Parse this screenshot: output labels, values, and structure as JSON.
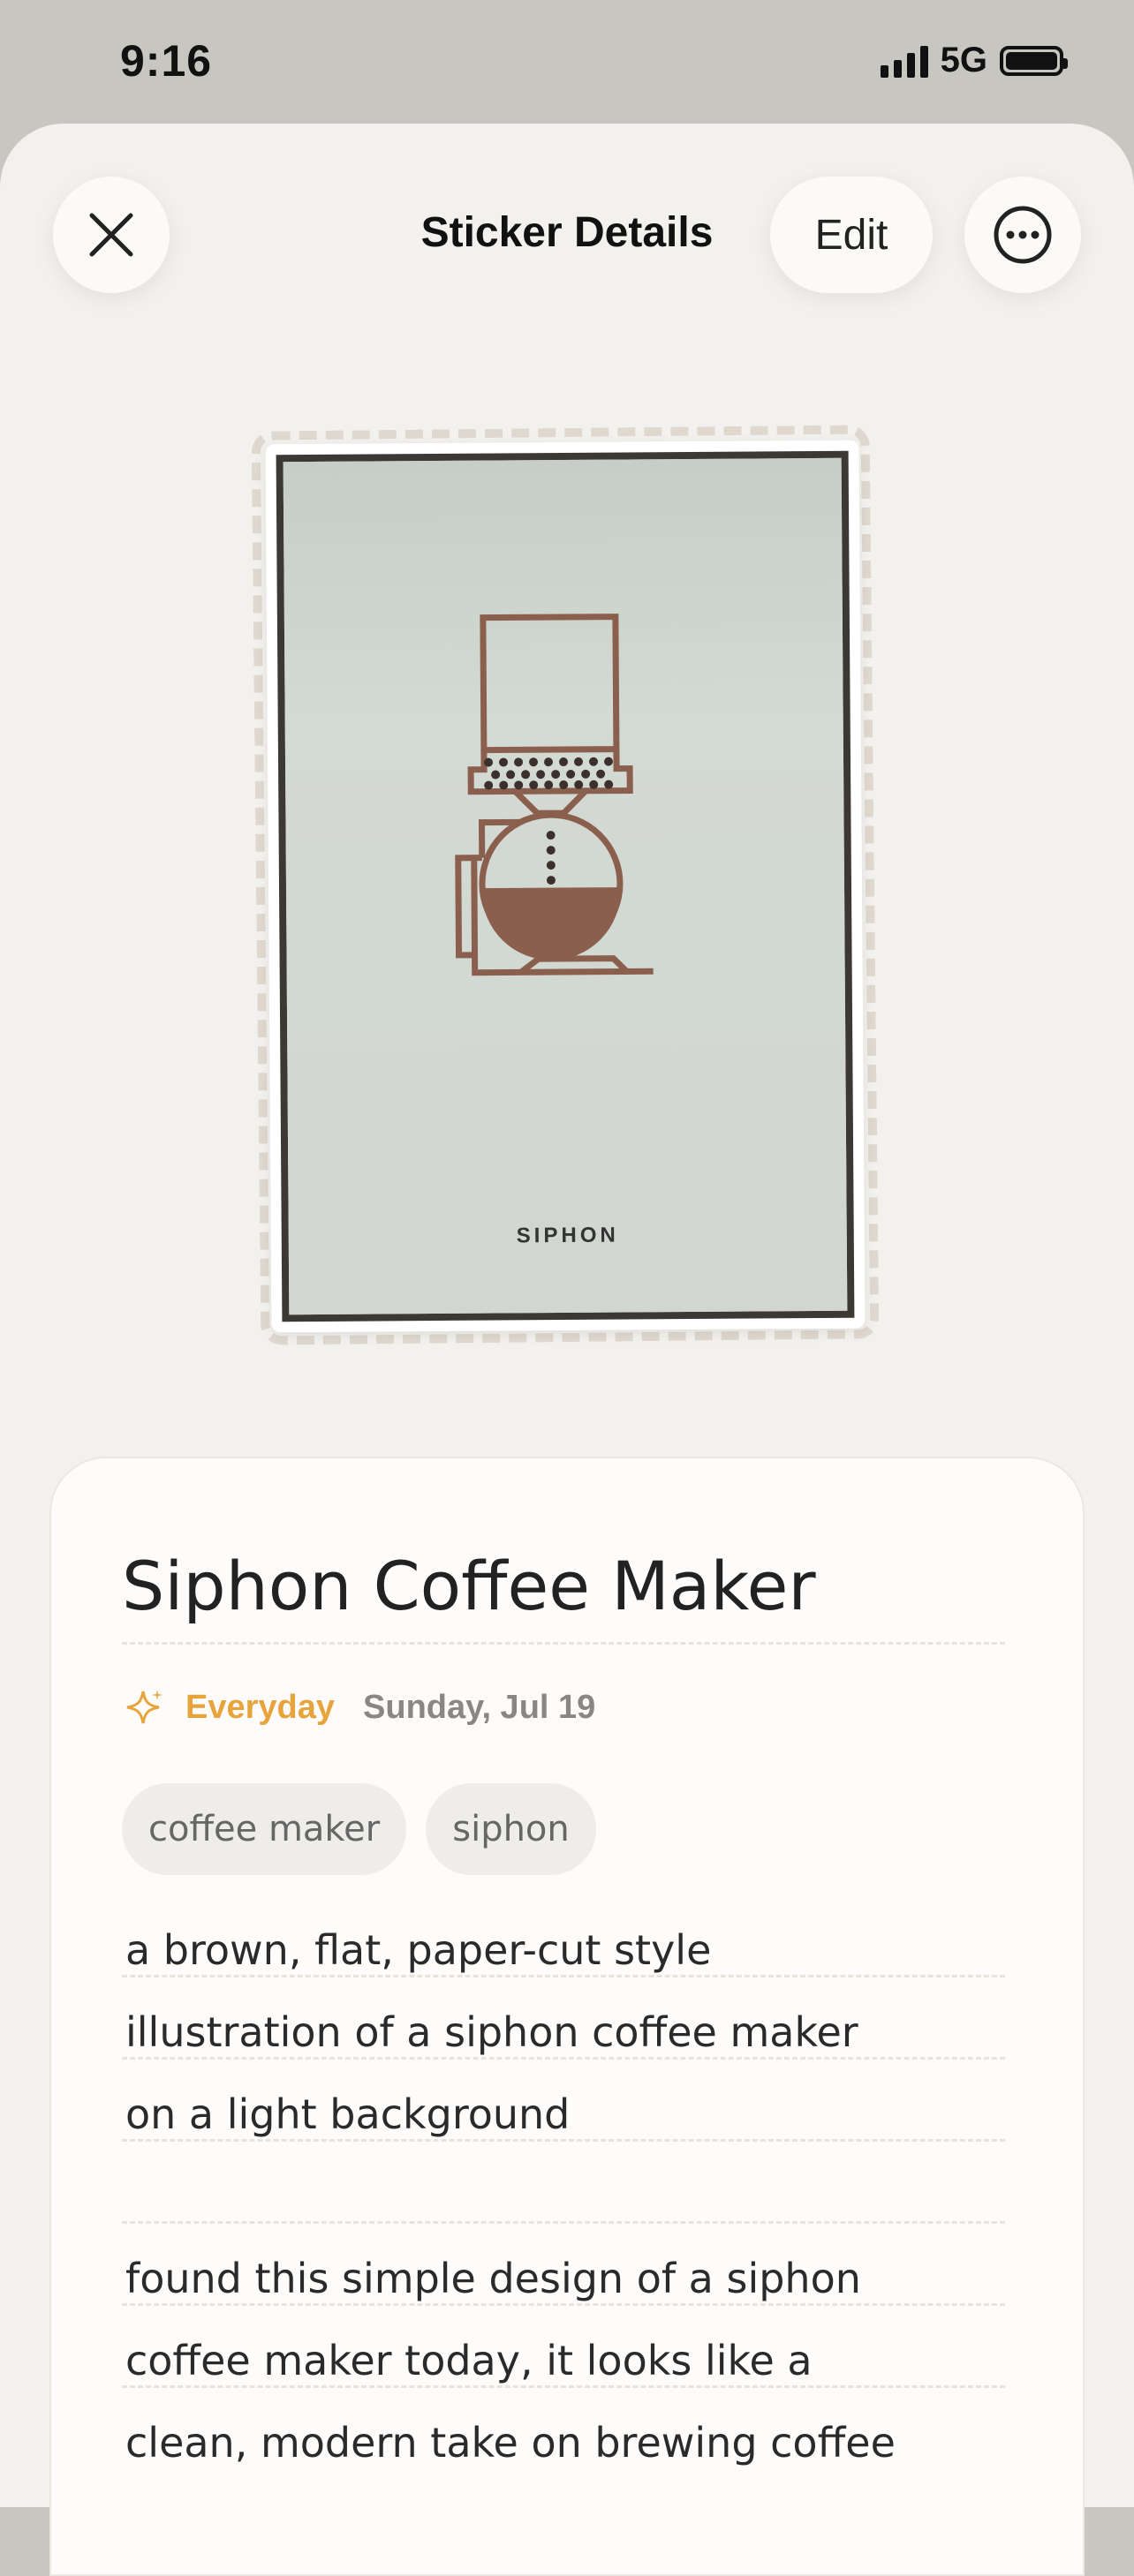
{
  "status_bar": {
    "time": "9:16",
    "network": "5G"
  },
  "header": {
    "title": "Sticker Details",
    "edit_label": "Edit"
  },
  "sticker": {
    "caption": "SIPHON",
    "colors": {
      "illustration": "#8a5f4e",
      "background": "#cfd6cf"
    }
  },
  "details": {
    "title": "Siphon Coffee Maker",
    "category": "Everyday",
    "date": "Sunday, Jul 19",
    "tags": [
      "coffee maker",
      "siphon"
    ],
    "description_lines": [
      "a brown, flat, paper-cut style",
      "illustration of a siphon coffee maker",
      "on a light background"
    ],
    "note_lines": [
      "found this simple design of a siphon",
      "coffee maker today, it looks like a",
      "clean, modern take on brewing coffee"
    ]
  },
  "colors": {
    "accent": "#e8a43b",
    "sheet_bg": "#f3f1ed",
    "card_bg": "#fdfcfa"
  }
}
